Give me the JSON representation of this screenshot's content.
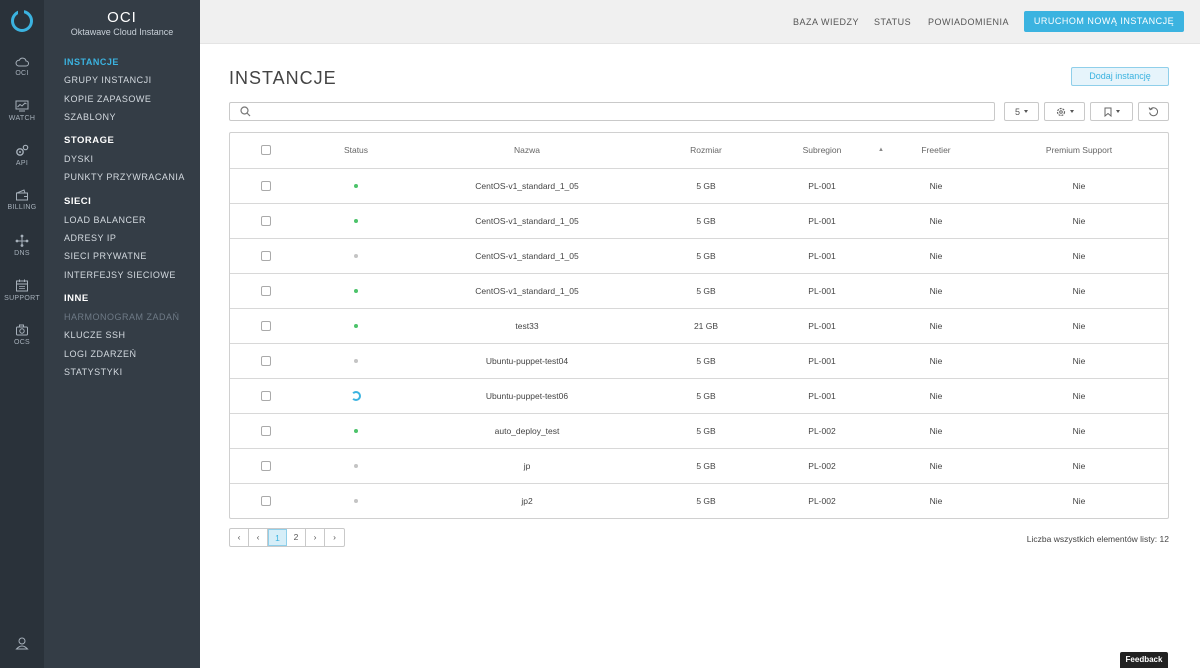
{
  "app": {
    "title": "OCI",
    "subtitle": "Oktawave Cloud Instance"
  },
  "iconbar": {
    "items": [
      {
        "label": "OCI",
        "icon": "cloud-icon"
      },
      {
        "label": "WATCH",
        "icon": "monitor-chart-icon"
      },
      {
        "label": "API",
        "icon": "gears-icon"
      },
      {
        "label": "BILLING",
        "icon": "wallet-icon"
      },
      {
        "label": "DNS",
        "icon": "network-nodes-icon"
      },
      {
        "label": "SUPPORT",
        "icon": "calendar-icon"
      },
      {
        "label": "OCS",
        "icon": "camera-icon"
      }
    ]
  },
  "sidebar": {
    "items": [
      {
        "label": "INSTANCJE",
        "type": "item",
        "state": "active"
      },
      {
        "label": "GRUPY INSTANCJI",
        "type": "item"
      },
      {
        "label": "KOPIE ZAPASOWE",
        "type": "item"
      },
      {
        "label": "SZABLONY",
        "type": "item"
      },
      {
        "label": "STORAGE",
        "type": "head"
      },
      {
        "label": "DYSKI",
        "type": "item"
      },
      {
        "label": "PUNKTY PRZYWRACANIA",
        "type": "item"
      },
      {
        "label": "SIECI",
        "type": "head"
      },
      {
        "label": "LOAD BALANCER",
        "type": "item"
      },
      {
        "label": "ADRESY IP",
        "type": "item"
      },
      {
        "label": "SIECI PRYWATNE",
        "type": "item"
      },
      {
        "label": "INTERFEJSY SIECIOWE",
        "type": "item"
      },
      {
        "label": "INNE",
        "type": "head"
      },
      {
        "label": "HARMONOGRAM ZADAŃ",
        "type": "item",
        "state": "disabled"
      },
      {
        "label": "KLUCZE SSH",
        "type": "item"
      },
      {
        "label": "LOGI ZDARZEŃ",
        "type": "item"
      },
      {
        "label": "STATYSTYKI",
        "type": "item"
      }
    ]
  },
  "topbar": {
    "links": [
      "BAZA WIEDZY",
      "STATUS",
      "POWIADOMIENIA"
    ],
    "new_instance_label": "URUCHOM NOWĄ INSTANCJĘ"
  },
  "main": {
    "title": "INSTANCJE",
    "add_label": "Dodaj instancję",
    "page_size": "5",
    "columns": [
      "Status",
      "Nazwa",
      "Rozmiar",
      "Subregion",
      "Freetier",
      "Premium Support"
    ],
    "rows": [
      {
        "status": "active",
        "name": "CentOS-v1_standard_1_05",
        "size": "5 GB",
        "subregion": "PL-001",
        "freetier": "Nie",
        "premium": "Nie"
      },
      {
        "status": "active",
        "name": "CentOS-v1_standard_1_05",
        "size": "5 GB",
        "subregion": "PL-001",
        "freetier": "Nie",
        "premium": "Nie"
      },
      {
        "status": "inactive",
        "name": "CentOS-v1_standard_1_05",
        "size": "5 GB",
        "subregion": "PL-001",
        "freetier": "Nie",
        "premium": "Nie"
      },
      {
        "status": "active",
        "name": "CentOS-v1_standard_1_05",
        "size": "5 GB",
        "subregion": "PL-001",
        "freetier": "Nie",
        "premium": "Nie"
      },
      {
        "status": "active",
        "name": "test33",
        "size": "21 GB",
        "subregion": "PL-001",
        "freetier": "Nie",
        "premium": "Nie"
      },
      {
        "status": "inactive",
        "name": "Ubuntu-puppet-test04",
        "size": "5 GB",
        "subregion": "PL-001",
        "freetier": "Nie",
        "premium": "Nie"
      },
      {
        "status": "loading",
        "name": "Ubuntu-puppet-test06",
        "size": "5 GB",
        "subregion": "PL-001",
        "freetier": "Nie",
        "premium": "Nie"
      },
      {
        "status": "active",
        "name": "auto_deploy_test",
        "size": "5 GB",
        "subregion": "PL-002",
        "freetier": "Nie",
        "premium": "Nie"
      },
      {
        "status": "inactive",
        "name": "jp",
        "size": "5 GB",
        "subregion": "PL-002",
        "freetier": "Nie",
        "premium": "Nie"
      },
      {
        "status": "inactive",
        "name": "jp2",
        "size": "5 GB",
        "subregion": "PL-002",
        "freetier": "Nie",
        "premium": "Nie"
      }
    ],
    "pagination": {
      "pages": [
        "1",
        "2"
      ],
      "current": "1"
    },
    "total_label": "Liczba wszystkich elementów listy: 12"
  },
  "feedback_label": "Feedback",
  "colors": {
    "accent": "#3bb3e0",
    "status_active": "#4cc36a",
    "status_inactive": "#c4c4c4",
    "sidebar_bg": "#343d46",
    "iconbar_bg": "#2a323a"
  }
}
